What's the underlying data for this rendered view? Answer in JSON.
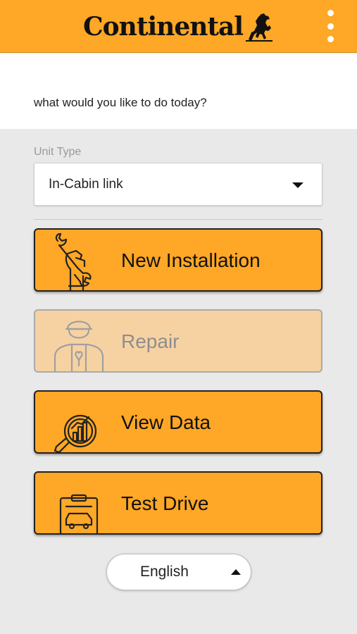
{
  "header": {
    "brand": "Continental",
    "logo_icon": "horse-icon",
    "menu_icon": "kebab-menu-icon",
    "color": "#ffa726"
  },
  "prompt": "what would you like to do today?",
  "unit_type": {
    "label": "Unit Type",
    "value": "In-Cabin link"
  },
  "actions": [
    {
      "label": "New Installation",
      "icon": "wrench-hand-icon",
      "enabled": true
    },
    {
      "label": "Repair",
      "icon": "mechanic-icon",
      "enabled": false
    },
    {
      "label": "View Data",
      "icon": "magnifier-chart-icon",
      "enabled": true
    },
    {
      "label": "Test Drive",
      "icon": "clipboard-car-icon",
      "enabled": true
    }
  ],
  "language": {
    "value": "English"
  },
  "colors": {
    "accent": "#ffa726",
    "disabled": "#f6d2a3"
  }
}
